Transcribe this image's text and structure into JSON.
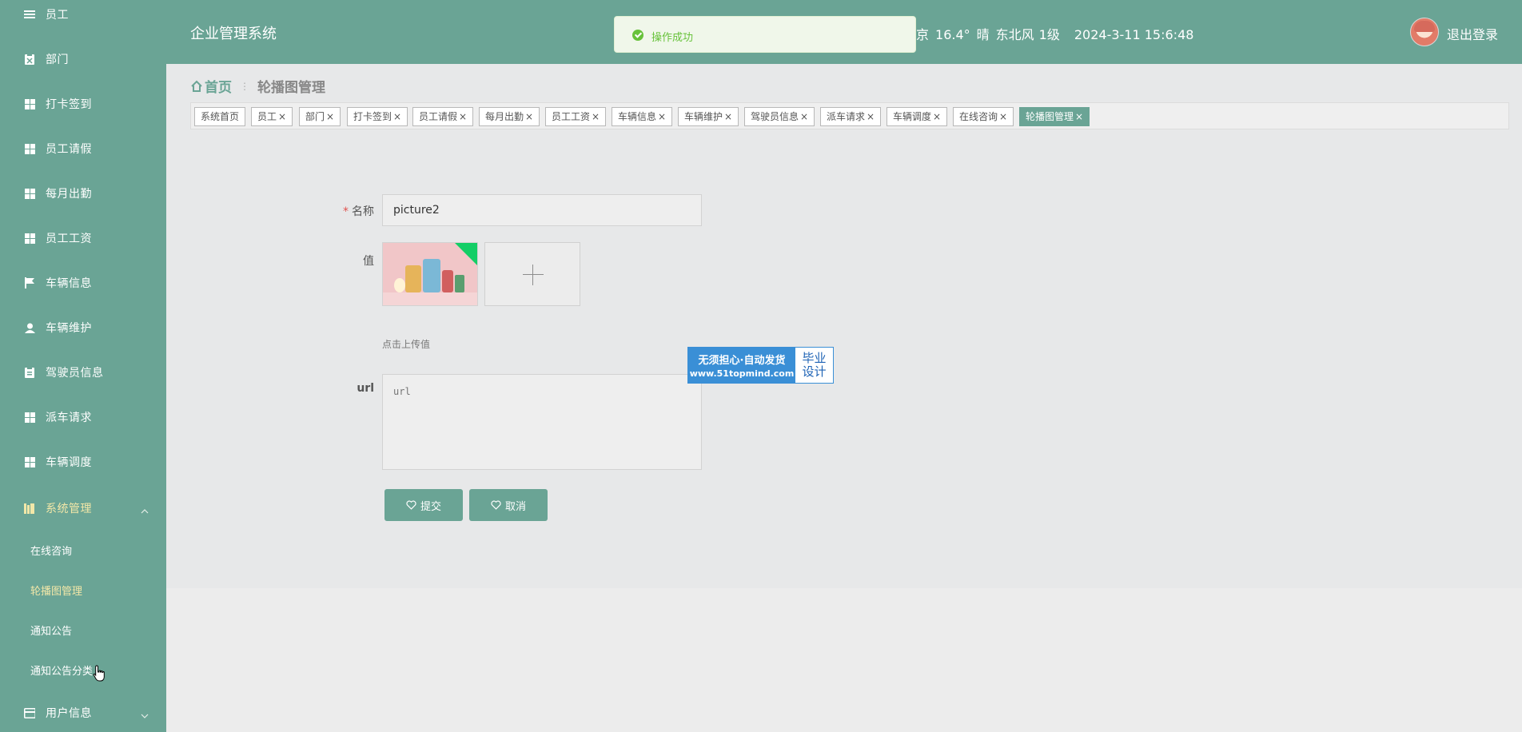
{
  "sidebar": {
    "items": [
      {
        "label": "员工",
        "icon": "menu-icon"
      },
      {
        "label": "部门",
        "icon": "clipboard-icon"
      },
      {
        "label": "打卡签到",
        "icon": "grid-icon"
      },
      {
        "label": "员工请假",
        "icon": "grid-icon"
      },
      {
        "label": "每月出勤",
        "icon": "grid-icon"
      },
      {
        "label": "员工工资",
        "icon": "grid-icon"
      },
      {
        "label": "车辆信息",
        "icon": "flag-icon"
      },
      {
        "label": "车辆维护",
        "icon": "user-icon"
      },
      {
        "label": "驾驶员信息",
        "icon": "clipboard-icon"
      },
      {
        "label": "派车请求",
        "icon": "grid-icon"
      },
      {
        "label": "车辆调度",
        "icon": "grid-icon"
      }
    ],
    "system": {
      "label": "系统管理",
      "icon": "book-icon"
    },
    "system_children": [
      "在线咨询",
      "轮播图管理",
      "通知公告",
      "通知公告分类"
    ],
    "user_info": {
      "label": "用户信息",
      "icon": "card-icon"
    }
  },
  "header": {
    "title": "企业管理系统",
    "weather": {
      "city": "京",
      "temp": "16.4°",
      "condition": "晴",
      "wind": "东北风",
      "level": "1级",
      "datetime": "2024-3-11 15:6:48"
    },
    "logout": "退出登录"
  },
  "toast": {
    "message": "操作成功"
  },
  "breadcrumb": {
    "home": "首页",
    "current": "轮播图管理"
  },
  "tags": [
    {
      "label": "系统首页",
      "closable": false
    },
    {
      "label": "员工",
      "closable": true
    },
    {
      "label": "部门",
      "closable": true
    },
    {
      "label": "打卡签到",
      "closable": true
    },
    {
      "label": "员工请假",
      "closable": true
    },
    {
      "label": "每月出勤",
      "closable": true
    },
    {
      "label": "员工工资",
      "closable": true
    },
    {
      "label": "车辆信息",
      "closable": true
    },
    {
      "label": "车辆维护",
      "closable": true
    },
    {
      "label": "驾驶员信息",
      "closable": true
    },
    {
      "label": "派车请求",
      "closable": true
    },
    {
      "label": "车辆调度",
      "closable": true
    },
    {
      "label": "在线咨询",
      "closable": true
    },
    {
      "label": "轮播图管理",
      "closable": true,
      "active": true
    }
  ],
  "close_glyph": "×",
  "form": {
    "name_label": "名称",
    "name_value": "picture2",
    "value_label": "值",
    "upload_hint": "点击上传值",
    "url_label": "url",
    "url_placeholder": "url",
    "submit": "提交",
    "cancel": "取消"
  },
  "watermark": {
    "line1": "无须担心·自动发货",
    "line2": "www.51topmind.com",
    "right1": "毕业",
    "right2": "设计"
  },
  "colors": {
    "primary": "#6aa495",
    "success": "#67c23a",
    "required": "#e0534f",
    "watermark": "#3a8fd6"
  }
}
